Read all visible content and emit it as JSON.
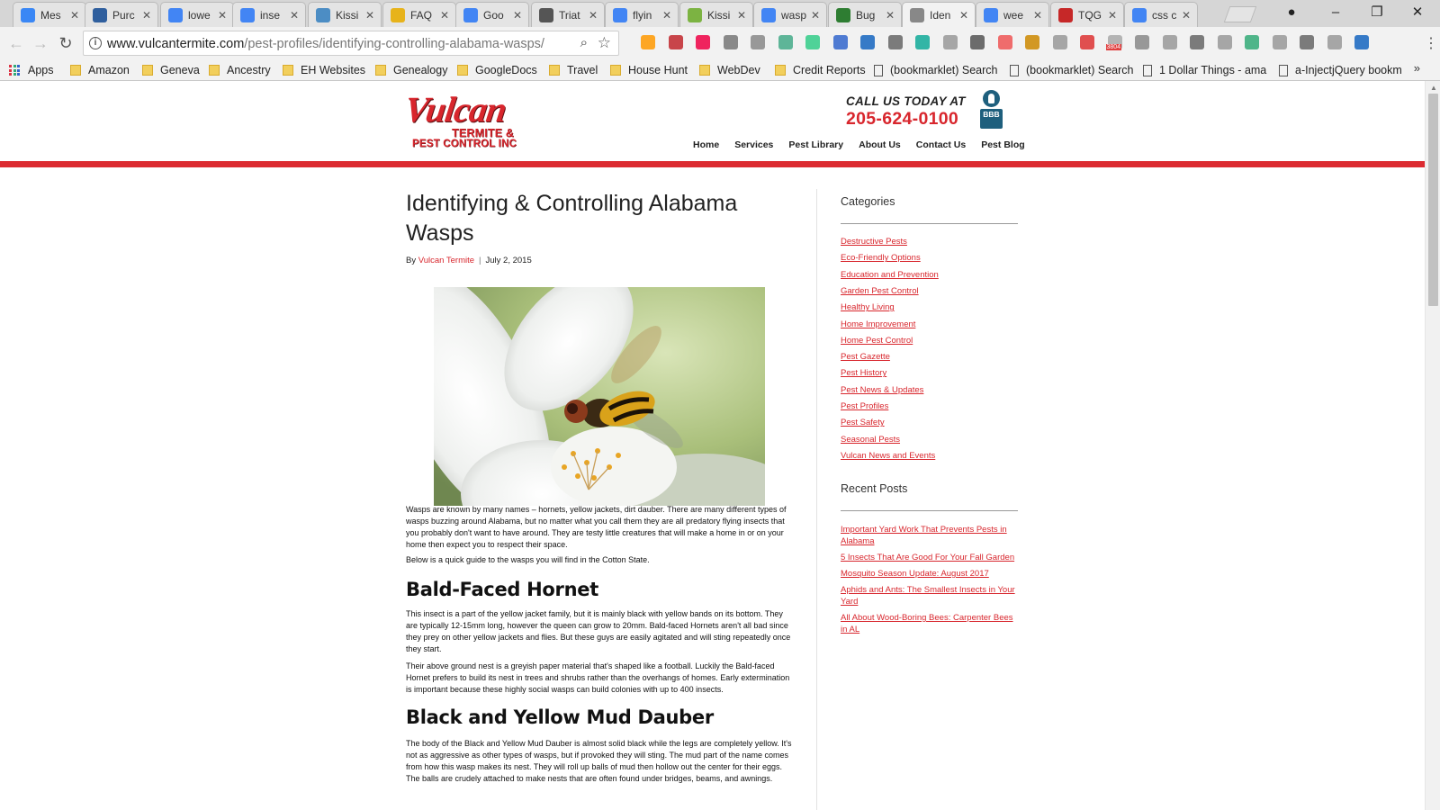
{
  "browser": {
    "tabs": [
      {
        "label": "Mes",
        "favicon": "messenger-icon",
        "color": "#3a87f5"
      },
      {
        "label": "Purc",
        "favicon": "cloud-icon",
        "color": "#2f5f9e"
      },
      {
        "label": "lowe",
        "favicon": "google-icon",
        "color": "#4285f4"
      },
      {
        "label": "inse",
        "favicon": "google-icon",
        "color": "#4285f4"
      },
      {
        "label": "Kissi",
        "favicon": "webmd-icon",
        "color": "#4c8dc4"
      },
      {
        "label": "FAQ",
        "favicon": "bug-icon",
        "color": "#e7b31b"
      },
      {
        "label": "Goo",
        "favicon": "google-icon",
        "color": "#4285f4"
      },
      {
        "label": "Triat",
        "favicon": "wikipedia-icon",
        "color": "#555555"
      },
      {
        "label": "flyin",
        "favicon": "google-icon",
        "color": "#4285f4"
      },
      {
        "label": "Kissi",
        "favicon": "bug-icon",
        "color": "#7cb342"
      },
      {
        "label": "wasp",
        "favicon": "google-icon",
        "color": "#4285f4"
      },
      {
        "label": "Bug",
        "favicon": "search-icon",
        "color": "#2e7d32"
      },
      {
        "label": "Iden",
        "favicon": "page-icon",
        "color": "#888888",
        "active": true
      },
      {
        "label": "wee",
        "favicon": "google-icon",
        "color": "#4285f4"
      },
      {
        "label": "TQG",
        "favicon": "bug-icon",
        "color": "#c62828"
      },
      {
        "label": "css c",
        "favicon": "google-icon",
        "color": "#4285f4"
      }
    ],
    "url_host": "www.vulcantermite.com",
    "url_path": "/pest-profiles/identifying-controlling-alabama-wasps/",
    "bookmarks": [
      {
        "label": "Apps",
        "type": "apps"
      },
      {
        "label": "Amazon",
        "type": "folder"
      },
      {
        "label": "Geneva",
        "type": "folder"
      },
      {
        "label": "Ancestry",
        "type": "folder"
      },
      {
        "label": "EH Websites",
        "type": "folder"
      },
      {
        "label": "Genealogy",
        "type": "folder"
      },
      {
        "label": "GoogleDocs",
        "type": "folder"
      },
      {
        "label": "Travel",
        "type": "folder"
      },
      {
        "label": "House Hunt",
        "type": "folder"
      },
      {
        "label": "WebDev",
        "type": "folder"
      },
      {
        "label": "Credit Reports",
        "type": "folder"
      },
      {
        "label": "(bookmarklet) Search",
        "type": "page"
      },
      {
        "label": "(bookmarklet) Search",
        "type": "page"
      },
      {
        "label": "1 Dollar Things - ama",
        "type": "page"
      },
      {
        "label": "a-InjectjQuery bookm",
        "type": "page"
      }
    ],
    "gmail_count": "3804"
  },
  "site": {
    "logo": {
      "word": "Vulcan",
      "line1": "TERMITE &",
      "line2": "PEST CONTROL INC"
    },
    "call_label": "CALL US TODAY AT",
    "phone": "205-624-0100",
    "bbb_label": "BBB",
    "nav": [
      "Home",
      "Services",
      "Pest Library",
      "About Us",
      "Contact Us",
      "Pest Blog"
    ],
    "accent_color": "#dc2b31"
  },
  "article": {
    "title": "Identifying & Controlling Alabama Wasps",
    "by_label": "By",
    "author": "Vulcan Termite",
    "date": "July 2, 2015",
    "intro": "Wasps are known by many names – hornets, yellow jackets, dirt dauber. There are many different types of wasps buzzing around Alabama, but no matter what you call them they are all predatory flying insects that you probably don't want to have around. They are testy little creatures that will make a home in or on your home then expect you to respect their space.",
    "guide": "Below is a quick guide to the wasps you will find in the Cotton State.",
    "sections": [
      {
        "heading": "Bald-Faced Hornet",
        "paragraphs": [
          "This insect is a part of the yellow jacket family, but it is mainly black with yellow bands on its bottom. They are typically 12-15mm long, however the queen can grow to 20mm. Bald-faced Hornets aren't all bad since they prey on other yellow jackets and flies. But these guys are easily agitated and will sting repeatedly once they start.",
          "Their above ground nest is a greyish paper material that's shaped like a football. Luckily the Bald-faced Hornet prefers to build its nest in trees and shrubs rather than the overhangs of homes. Early extermination is important because these highly social wasps can build colonies with up to 400 insects."
        ]
      },
      {
        "heading": "Black and Yellow Mud Dauber",
        "paragraphs": [
          "The body of the Black and Yellow Mud Dauber is almost solid black while the legs are completely yellow. It's not as aggressive as other types of wasps, but if provoked they will sting. The mud part of the name comes from how this wasp makes its nest. They will roll up balls of mud then hollow out the center for their eggs. The balls are crudely attached to make nests that are often found under bridges, beams, and awnings."
        ]
      }
    ]
  },
  "sidebar": {
    "categories_title": "Categories",
    "categories": [
      "Destructive Pests",
      "Eco-Friendly Options",
      "Education and Prevention",
      "Garden Pest Control",
      "Healthy Living",
      "Home Improvement",
      "Home Pest Control",
      "Pest Gazette",
      "Pest History",
      "Pest News & Updates",
      "Pest Profiles",
      "Pest Safety",
      "Seasonal Pests",
      "Vulcan News and Events"
    ],
    "recent_title": "Recent Posts",
    "recent_posts": [
      "Important Yard Work That Prevents Pests in Alabama",
      "5 Insects That Are Good For Your Fall Garden",
      "Mosquito Season Update: August 2017",
      "Aphids and Ants: The Smallest Insects in Your Yard",
      "All About Wood-Boring Bees: Carpenter Bees in AL"
    ]
  }
}
